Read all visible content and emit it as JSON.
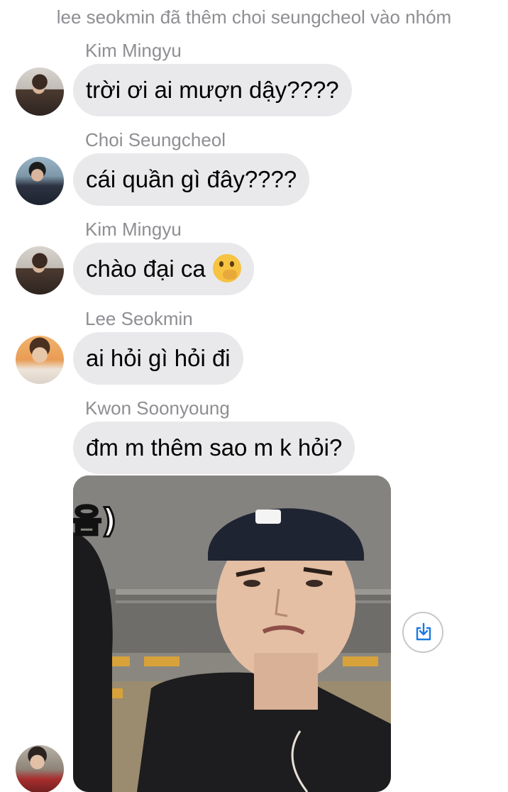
{
  "system_note": "lee seokmin đã thêm choi seungcheol vào nhóm",
  "messages": [
    {
      "sender": "Kim Mingyu",
      "text": "trời ơi ai mượn dậy????"
    },
    {
      "sender": "Choi Seungcheol",
      "text": "cái quần gì đây????"
    },
    {
      "sender": "Kim Mingyu",
      "text": "chào đại ca",
      "emoji": "face-with-hand-over-mouth"
    },
    {
      "sender": "Lee Seokmin",
      "text": "ai hỏi gì hỏi đi"
    },
    {
      "sender": "Kwon Soonyoung",
      "text": "đm m thêm sao m k hỏi?"
    }
  ],
  "photo": {
    "caption_fragment": "음)",
    "share_icon": "share-icon"
  },
  "colors": {
    "bubble": "#e9e9eb",
    "sender_name": "#8e8e93",
    "system_note": "#8e8e93",
    "share_icon": "#1a7ae0"
  }
}
